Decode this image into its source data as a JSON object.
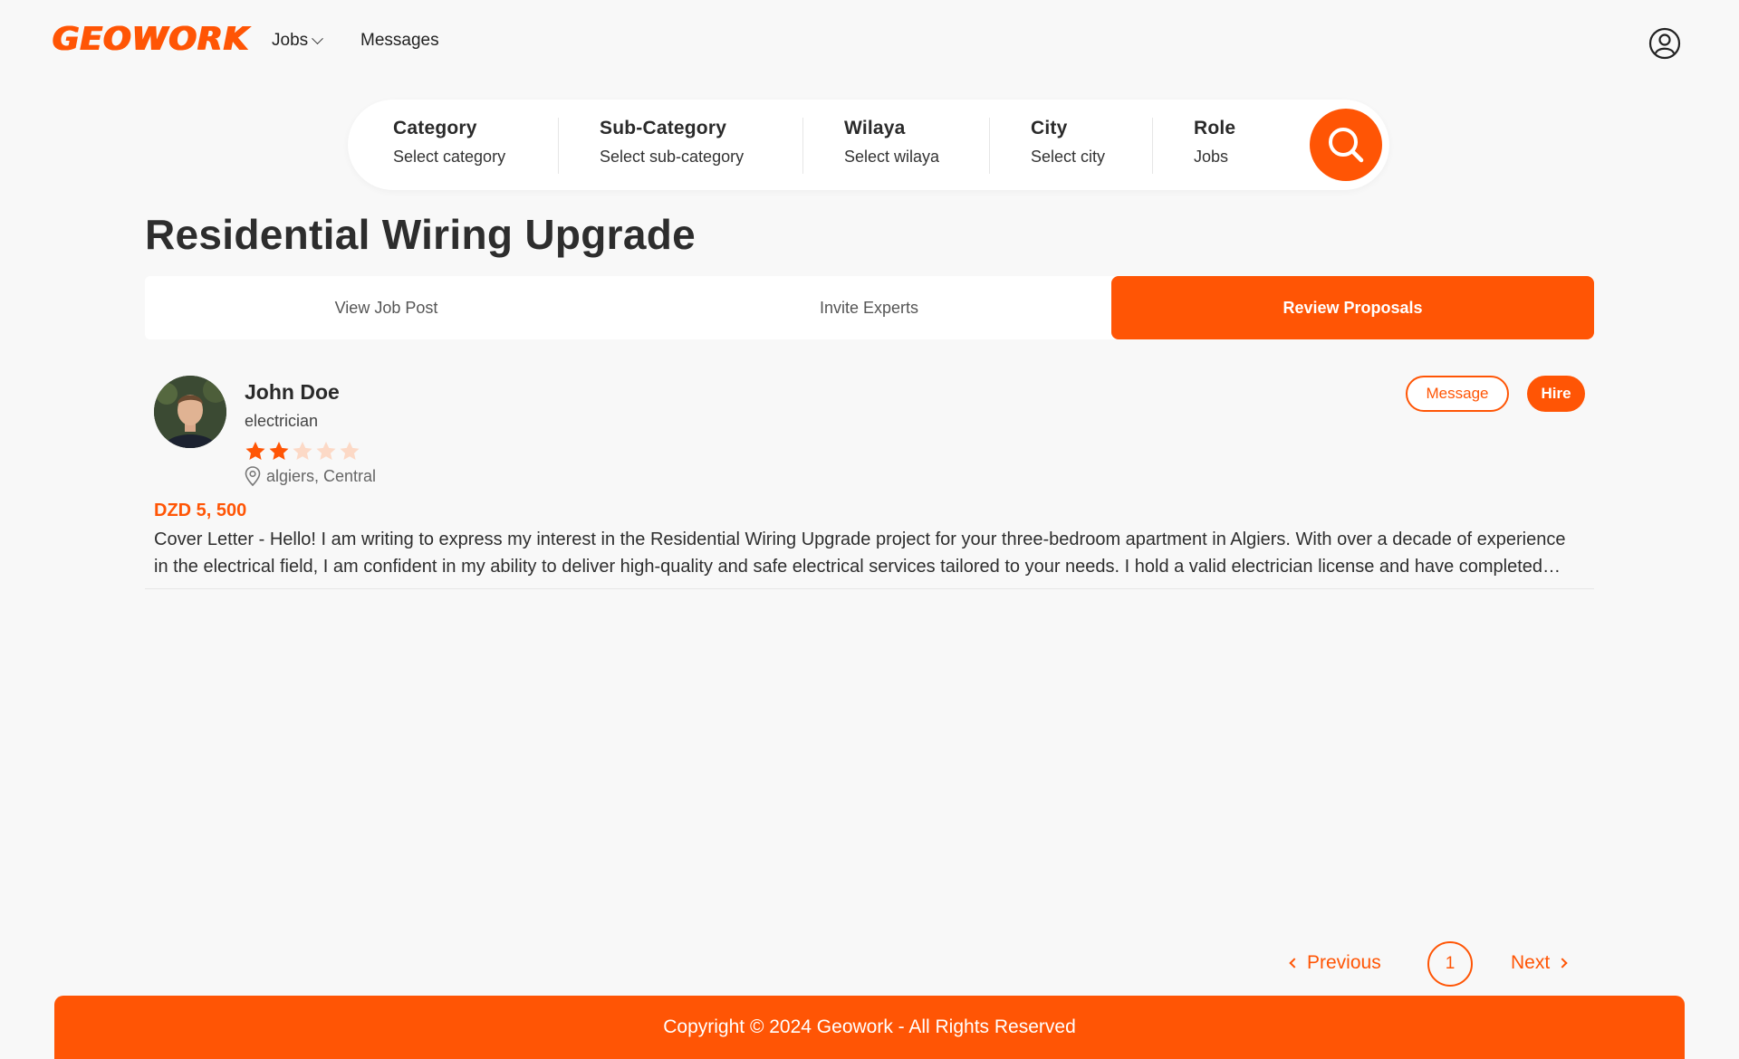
{
  "brand": {
    "name": "GEOWORK",
    "accent_color": "#ff5505"
  },
  "nav": {
    "jobs_label": "Jobs",
    "messages_label": "Messages",
    "user_icon": "user-circle-icon"
  },
  "search": {
    "fields": [
      {
        "label": "Category",
        "value": "Select category"
      },
      {
        "label": "Sub-Category",
        "value": "Select sub-category"
      },
      {
        "label": "Wilaya",
        "value": "Select wilaya"
      },
      {
        "label": "City",
        "value": "Select city"
      },
      {
        "label": "Role",
        "value": "Jobs"
      }
    ],
    "button_icon": "search-icon"
  },
  "job": {
    "title": "Residential Wiring Upgrade"
  },
  "tabs": [
    {
      "label": "View Job Post",
      "active": false
    },
    {
      "label": "Invite Experts",
      "active": false
    },
    {
      "label": "Review Proposals",
      "active": true
    }
  ],
  "proposal": {
    "name": "John Doe",
    "role": "electrician",
    "rating": 2,
    "rating_max": 5,
    "location": "algiers, Central",
    "price": "DZD 5, 500",
    "cover_letter": "Cover Letter - Hello! I am writing to express my interest in the Residential Wiring Upgrade project for your three-bedroom apartment in Algiers. With over a decade of experience in the electrical field, I am confident in my ability to deliver high-quality and safe electrical services tailored to your needs. I hold a valid electrician license and have completed numerous residential projects of similar scope.",
    "message_label": "Message",
    "hire_label": "Hire"
  },
  "pagination": {
    "previous_label": "Previous",
    "current_page": "1",
    "next_label": "Next"
  },
  "footer": {
    "copyright": "Copyright © 2024 Geowork - All Rights Reserved"
  }
}
